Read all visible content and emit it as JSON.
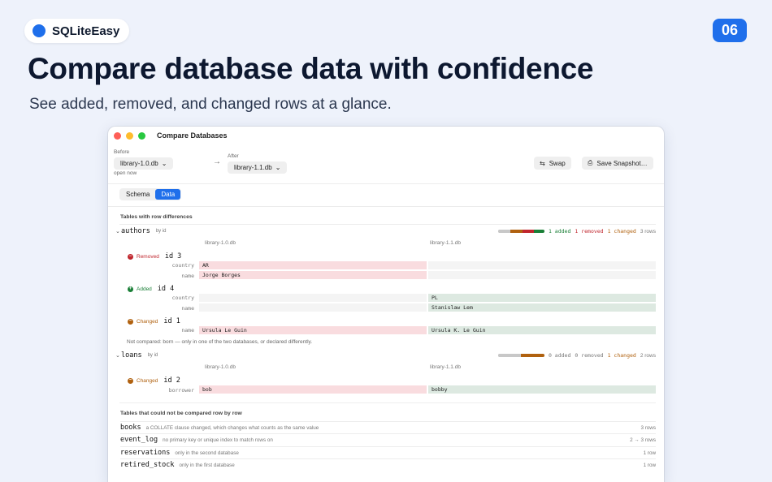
{
  "brand": {
    "name": "SQLiteEasy",
    "badge": "06"
  },
  "headline": "Compare database data with confidence",
  "subline": "See added, removed, and changed rows at a glance.",
  "window": {
    "title": "Compare Databases",
    "before_label": "Before",
    "before_db": "library-1.0.db",
    "before_note": "open now",
    "after_label": "After",
    "after_db": "library-1.1.db",
    "swap_label": "Swap",
    "save_label": "Save Snapshot…",
    "tabs": {
      "schema": "Schema",
      "data": "Data"
    },
    "section_diff": "Tables with row differences",
    "authors": {
      "name": "authors",
      "key": "by id",
      "added": "1 added",
      "removed": "1 removed",
      "changed": "1 changed",
      "rows": "3 rows",
      "col_before": "library-1.0.db",
      "col_after": "library-1.1.db",
      "r1": {
        "status": "Removed",
        "id": "id 3",
        "f1": "country",
        "v1b": "AR",
        "f2": "name",
        "v2b": "Jorge Borges"
      },
      "r2": {
        "status": "Added",
        "id": "id 4",
        "f1": "country",
        "v1a": "PL",
        "f2": "name",
        "v2a": "Stanislaw Lem"
      },
      "r3": {
        "status": "Changed",
        "id": "id 1",
        "f1": "name",
        "v1b": "Ursula Le Guin",
        "v1a": "Ursula K. Le Guin"
      },
      "note": "Not compared: born — only in one of the two databases, or declared differently."
    },
    "loans": {
      "name": "loans",
      "key": "by id",
      "added": "0 added",
      "removed": "0 removed",
      "changed": "1 changed",
      "rows": "2 rows",
      "col_before": "library-1.0.db",
      "col_after": "library-1.1.db",
      "r1": {
        "status": "Changed",
        "id": "id 2",
        "f1": "borrower",
        "v1b": "bob",
        "v1a": "bobby"
      }
    },
    "section_uncomparable": "Tables that could not be compared row by row",
    "uncomparable": [
      {
        "name": "books",
        "desc": "a COLLATE clause changed, which changes what counts as the same value",
        "rows": "3 rows"
      },
      {
        "name": "event_log",
        "desc": "no primary key or unique index to match rows on",
        "rows": "2 → 3 rows"
      },
      {
        "name": "reservations",
        "desc": "only in the second database",
        "rows": "1 row"
      },
      {
        "name": "retired_stock",
        "desc": "only in the first database",
        "rows": "1 row"
      }
    ],
    "colors": {
      "accent": "#1f6feb",
      "added": "#1a7f37",
      "removed": "#c0262d",
      "changed": "#b0610f"
    }
  }
}
